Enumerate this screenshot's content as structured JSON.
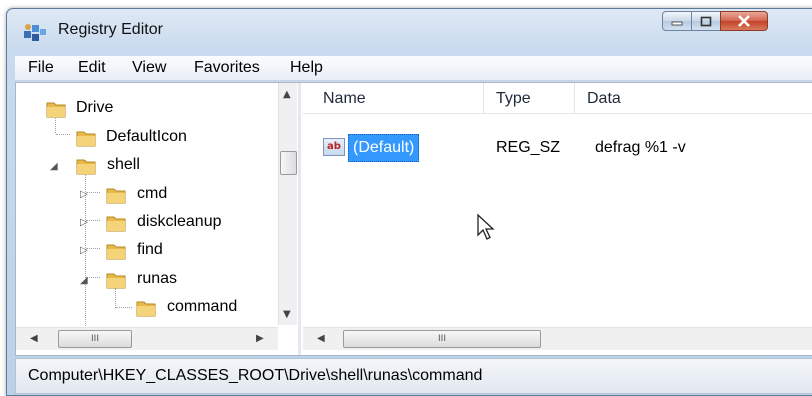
{
  "window": {
    "title": "Registry Editor",
    "accent": "#3399ff",
    "close_color": "#c34227"
  },
  "menu": [
    "File",
    "Edit",
    "View",
    "Favorites",
    "Help"
  ],
  "tree": {
    "items": [
      {
        "label": "Drive",
        "icon": "folder-icon",
        "expander": ""
      },
      {
        "label": "DefaultIcon",
        "icon": "folder-icon",
        "expander": ""
      },
      {
        "label": "shell",
        "icon": "folder-open-icon",
        "expander": "expanded"
      },
      {
        "label": "cmd",
        "icon": "folder-icon",
        "expander": "collapsed"
      },
      {
        "label": "diskcleanup",
        "icon": "folder-icon",
        "expander": "collapsed"
      },
      {
        "label": "find",
        "icon": "folder-icon",
        "expander": "collapsed"
      },
      {
        "label": "runas",
        "icon": "folder-open-icon",
        "expander": "expanded"
      },
      {
        "label": "command",
        "icon": "folder-icon",
        "expander": ""
      }
    ],
    "hscroll_grip": "III"
  },
  "list": {
    "columns": [
      "Name",
      "Type",
      "Data"
    ],
    "rows": [
      {
        "name": "(Default)",
        "type": "REG_SZ",
        "data": "defrag %1 -v",
        "icon": "string-value-icon",
        "icon_text": "ab"
      }
    ],
    "hscroll_grip": "III"
  },
  "status": {
    "path": "Computer\\HKEY_CLASSES_ROOT\\Drive\\shell\\runas\\command"
  }
}
